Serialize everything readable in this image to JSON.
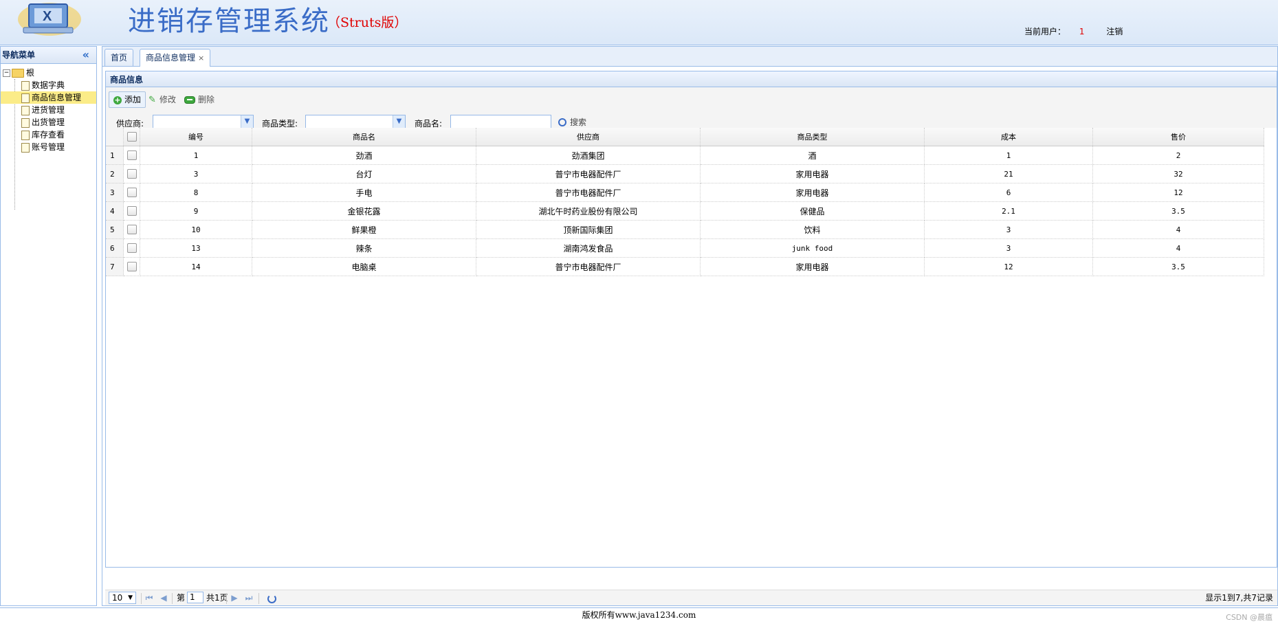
{
  "header": {
    "title": "进销存管理系统",
    "subtitle": "（Struts版）",
    "current_user_label": "当前用户：",
    "current_user": "1",
    "logout": "注销"
  },
  "nav": {
    "title": "导航菜单",
    "root": "根",
    "items": [
      {
        "label": "数据字典",
        "selected": false
      },
      {
        "label": "商品信息管理",
        "selected": true
      },
      {
        "label": "进货管理",
        "selected": false
      },
      {
        "label": "出货管理",
        "selected": false
      },
      {
        "label": "库存查看",
        "selected": false
      },
      {
        "label": "账号管理",
        "selected": false
      }
    ]
  },
  "tabs": [
    {
      "label": "首页",
      "active": false
    },
    {
      "label": "商品信息管理",
      "active": true,
      "close": "×"
    }
  ],
  "panel": {
    "title": "商品信息"
  },
  "toolbar": {
    "add": "添加",
    "edit": "修改",
    "delete": "删除"
  },
  "search": {
    "supplier_label": "供应商:",
    "type_label": "商品类型:",
    "name_label": "商品名:",
    "button": "搜索"
  },
  "table": {
    "columns": [
      "编号",
      "商品名",
      "供应商",
      "商品类型",
      "成本",
      "售价"
    ],
    "rows": [
      {
        "n": "1",
        "id": "1",
        "name": "劲酒",
        "supplier": "劲酒集团",
        "type": "酒",
        "cost": "1",
        "price": "2"
      },
      {
        "n": "2",
        "id": "3",
        "name": "台灯",
        "supplier": "普宁市电器配件厂",
        "type": "家用电器",
        "cost": "21",
        "price": "32"
      },
      {
        "n": "3",
        "id": "8",
        "name": "手电",
        "supplier": "普宁市电器配件厂",
        "type": "家用电器",
        "cost": "6",
        "price": "12"
      },
      {
        "n": "4",
        "id": "9",
        "name": "金银花露",
        "supplier": "湖北午时药业股份有限公司",
        "type": "保健品",
        "cost": "2.1",
        "price": "3.5"
      },
      {
        "n": "5",
        "id": "10",
        "name": "鲜果橙",
        "supplier": "顶新国际集团",
        "type": "饮料",
        "cost": "3",
        "price": "4"
      },
      {
        "n": "6",
        "id": "13",
        "name": "辣条",
        "supplier": "湖南鸿发食品",
        "type": "junk food",
        "cost": "3",
        "price": "4"
      },
      {
        "n": "7",
        "id": "14",
        "name": "电脑桌",
        "supplier": "普宁市电器配件厂",
        "type": "家用电器",
        "cost": "12",
        "price": "3.5"
      }
    ]
  },
  "pager": {
    "page_size": "10",
    "page_prefix": "第",
    "page_value": "1",
    "page_suffix": "共1页",
    "info": "显示1到7,共7记录"
  },
  "footer": {
    "copyright": "版权所有www.java1234.com",
    "watermark": "CSDN @晨瘟"
  },
  "colors": {
    "accent": "#3a6cc7",
    "border": "#99bbe8",
    "selected": "#fbec88",
    "user": "#e00000"
  }
}
